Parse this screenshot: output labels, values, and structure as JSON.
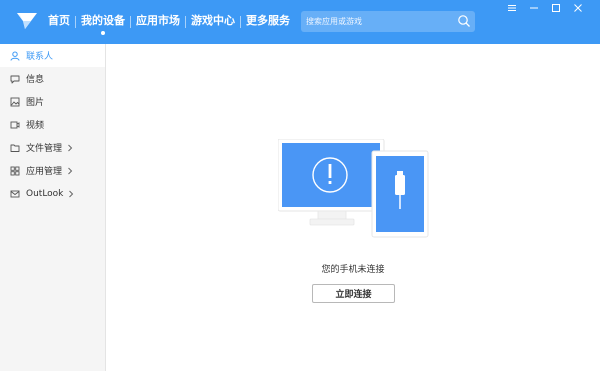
{
  "nav": {
    "items": [
      {
        "label": "首页"
      },
      {
        "label": "我的设备"
      },
      {
        "label": "应用市场"
      },
      {
        "label": "游戏中心"
      },
      {
        "label": "更多服务"
      }
    ],
    "active_index": 1
  },
  "search": {
    "placeholder": "搜索应用或游戏",
    "icon": "search-icon"
  },
  "window_controls": [
    "menu-icon",
    "minimize-icon",
    "maximize-icon",
    "close-icon"
  ],
  "sidebar": {
    "items": [
      {
        "label": "联系人",
        "icon": "contacts-icon",
        "active": true
      },
      {
        "label": "信息",
        "icon": "message-icon"
      },
      {
        "label": "图片",
        "icon": "picture-icon"
      },
      {
        "label": "视频",
        "icon": "video-icon"
      },
      {
        "label": "文件管理",
        "icon": "folder-icon",
        "expandable": true
      },
      {
        "label": "应用管理",
        "icon": "apps-icon",
        "expandable": true
      },
      {
        "label": "OutLook",
        "icon": "mail-icon",
        "expandable": true
      }
    ]
  },
  "main": {
    "status_text": "您的手机未连接",
    "connect_label": "立即连接"
  },
  "colors": {
    "accent": "#3d99f5",
    "sidebar_bg": "#f5f5f5"
  }
}
